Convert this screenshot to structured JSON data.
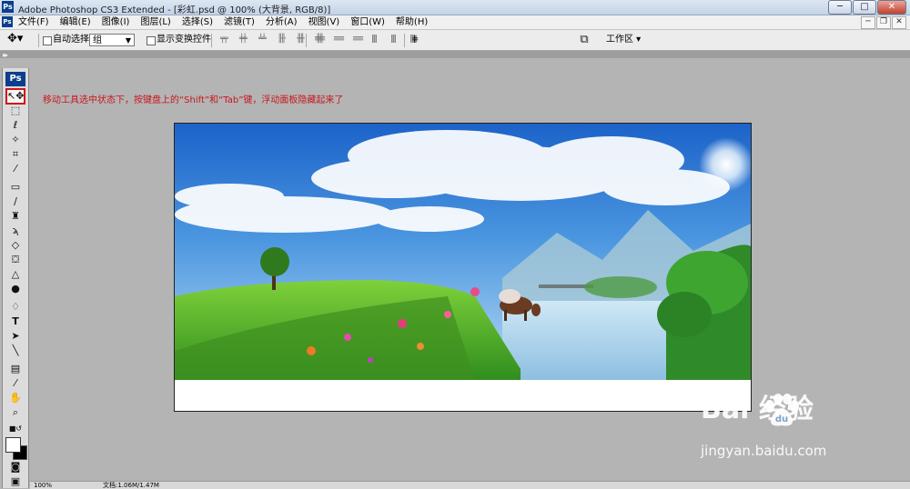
{
  "window": {
    "title": "Adobe Photoshop CS3 Extended - [彩虹.psd @ 100% (大背景, RGB/8)]",
    "app_icon": "Ps",
    "minimize_label": "─",
    "maximize_label": "□",
    "close_label": "✕"
  },
  "menubar": {
    "items": [
      "文件(F)",
      "编辑(E)",
      "图像(I)",
      "图层(L)",
      "选择(S)",
      "滤镜(T)",
      "分析(A)",
      "视图(V)",
      "窗口(W)",
      "帮助(H)"
    ],
    "doc_minimize": "─",
    "doc_restore": "❐",
    "doc_close": "✕"
  },
  "options_bar": {
    "auto_select_label": "自动选择:",
    "auto_select_value": "组",
    "show_transform_label": "显示变换控件",
    "workspace_label": "工作区 ▾"
  },
  "toolbox": {
    "logo": "Ps"
  },
  "instruction_text": "移动工具选中状态下，按键盘上的“Shift”和“Tab”键，浮动面板隐藏起来了",
  "status_bar": {
    "zoom": "100%",
    "doc_info": "文档:1.06M/1.47M"
  },
  "watermark": {
    "brand": "Bai  经验",
    "url": "jingyan.baidu.com"
  },
  "colors": {
    "instruction": "#c8151c",
    "workspace_bg": "#b4b4b4",
    "ps_blue": "#0b3f8c"
  }
}
